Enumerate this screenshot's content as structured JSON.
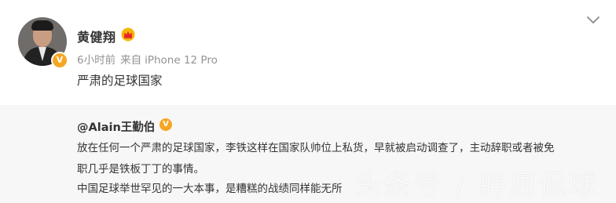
{
  "post": {
    "username": "黄健翔",
    "time": "6小时前",
    "source_prefix": "来自",
    "device": "iPhone 12 Pro",
    "text": "严肃的足球国家",
    "verify_mark": "V"
  },
  "repost": {
    "author": "@Alain王勤伯",
    "verify_mark": "V",
    "lines": [
      "放在任何一个严肃的足球国家，李铁这样在国家队帅位上私货，早就被启动调查了，主动辞职或者被免",
      "职几乎是铁板丁丁的事情。",
      "中国足球举世罕见的一大本事，是糟糕的战绩同样能无所"
    ]
  },
  "watermark": "头条号 / 胖周侃球",
  "colors": {
    "meta_gray": "#939393",
    "repost_bg": "#f7f7f7",
    "verify_orange": "#f6a623"
  }
}
